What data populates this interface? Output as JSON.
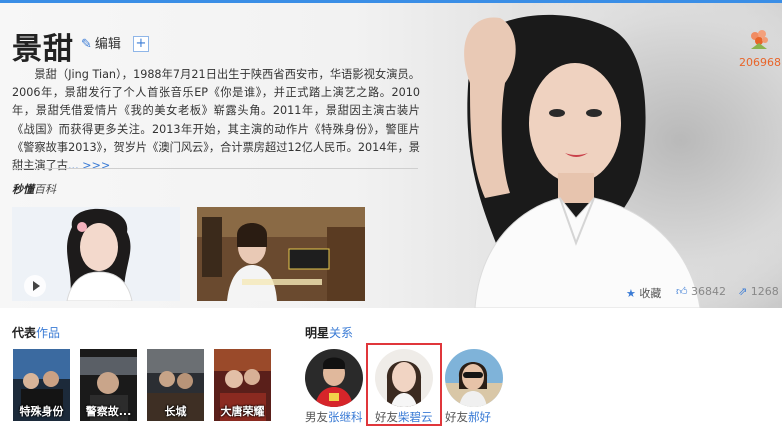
{
  "colors": {
    "accent": "#3a7bd5",
    "top_bar": "#3a8ee6",
    "highlight": "#e0363b",
    "counter": "#e8652a"
  },
  "header": {
    "title": "景甜",
    "edit_label": "编辑",
    "edit_icon": "pencil-icon",
    "add_icon": "plus-square-icon"
  },
  "summary": {
    "text": "景甜（Jing Tian），1988年7月21日出生于陕西省西安市，华语影视女演员。2006年，景甜发行了个人首张音乐EP《你是谁》，并正式踏上演艺之路。2010年，景甜凭借爱情片《我的美女老板》崭露头角。2011年，景甜因主演古装片《战国》而获得更多关注。2013年开始，其主演的动作片《特殊身份》，警匪片《警察故事2013》，贺岁片《澳门风云》，合计票房超过12亿人民币。2014年，景甜主演了古",
    "more": "... >>>"
  },
  "video": {
    "logo": "秒懂",
    "logo_tail": "百科",
    "items": [
      {
        "icon": "play-icon"
      },
      {
        "icon": "video-thumbnail"
      }
    ]
  },
  "counter": {
    "value": "206968",
    "icon": "flower-icon"
  },
  "stats": {
    "collect_label": "收藏",
    "collect_icon": "star-icon",
    "likes": "36842",
    "likes_icon": "thumbs-up-icon",
    "shares": "1268",
    "shares_icon": "share-icon"
  },
  "works": {
    "title_prefix": "代表",
    "title_highlight": "作品",
    "items": [
      {
        "label": "特殊身份"
      },
      {
        "label": "警察故..."
      },
      {
        "label": "长城"
      },
      {
        "label": "大唐荣耀"
      }
    ]
  },
  "relations": {
    "title_prefix": "明星",
    "title_highlight": "关系",
    "items": [
      {
        "relation": "男友",
        "name": "张继科"
      },
      {
        "relation": "好友",
        "name": "柴碧云"
      },
      {
        "relation": "好友",
        "name": "郝好"
      }
    ]
  }
}
